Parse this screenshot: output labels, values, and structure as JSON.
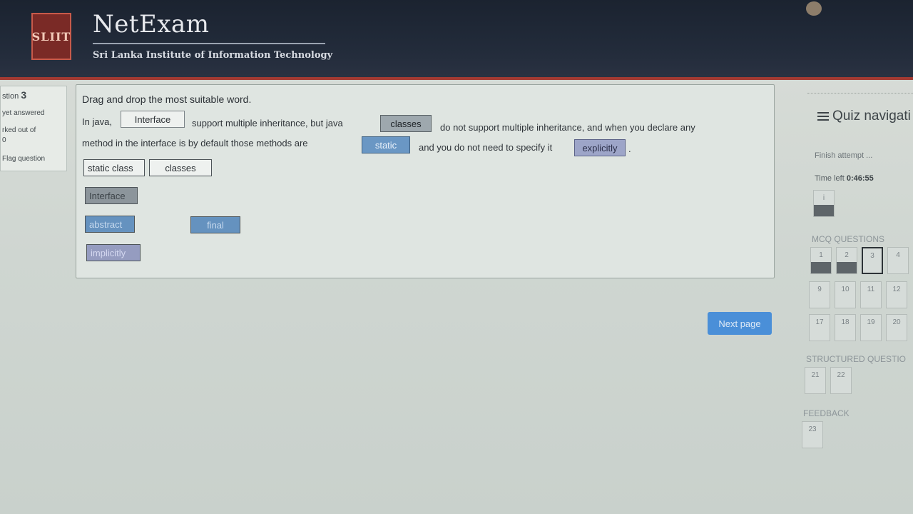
{
  "header": {
    "logo_text": "SLIIT",
    "app_title": "NetExam",
    "subtitle": "Sri Lanka Institute of Information Technology"
  },
  "info": {
    "question_prefix": "stion",
    "question_number": "3",
    "status": "yet answered",
    "marked": "rked out of",
    "marks": "0",
    "flag": "Flag question"
  },
  "question": {
    "instruction": "Drag and drop the most suitable word.",
    "s1": "In java,",
    "s2": "support multiple inheritance, but java",
    "s3": "do not support multiple inheritance, and when you declare  any",
    "s4": "method in the interface is by default those methods are",
    "s5": "and you do not need to specify it",
    "s6": ".",
    "drop1": "Interface",
    "drop2": "classes",
    "drop3": "static",
    "drop4": "explicitly"
  },
  "choices": [
    "static class",
    "classes",
    "Interface",
    "abstract",
    "final",
    "implicitly"
  ],
  "next_button": "Next page",
  "nav": {
    "title": "Quiz navigati",
    "finish": "Finish attempt ...",
    "time_label": "Time left",
    "time_value": "0:46:55",
    "info_btn": "i",
    "mcq_label": "MCQ QUESTIONS",
    "mcq_row1": [
      "1",
      "2",
      "3",
      "4"
    ],
    "mcq_row2": [
      "9",
      "10",
      "11",
      "12"
    ],
    "mcq_row3": [
      "17",
      "18",
      "19",
      "20"
    ],
    "structured_label": "STRUCTURED QUESTIO",
    "structured": [
      "21",
      "22"
    ],
    "feedback_label": "FEEDBACK",
    "feedback": [
      "23"
    ]
  }
}
